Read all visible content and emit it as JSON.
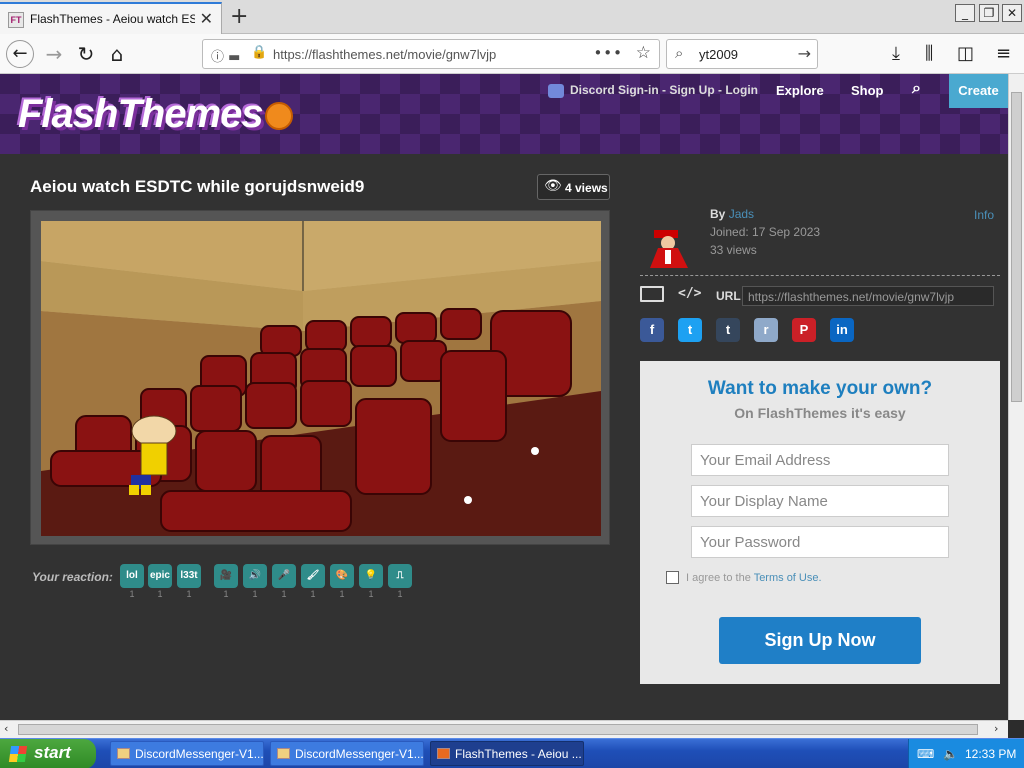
{
  "browser": {
    "tab_title": "FlashThemes - Aeiou watch ESDTC",
    "favicon_text": "FT",
    "url": "https://flashthemes.net/movie/gnw7lvjp",
    "search_value": "yt2009"
  },
  "site": {
    "logo": "FlashThemes",
    "discord_link": "Discord Sign-in - Sign Up - Login",
    "nav": [
      "Explore",
      "Shop"
    ],
    "create_label": "Create"
  },
  "movie": {
    "title": "Aeiou watch ESDTC while gorujdsnweid9",
    "views": "4 views",
    "reaction_label": "Your reaction:",
    "reactions": [
      {
        "label": "lol",
        "count": "1"
      },
      {
        "label": "epic",
        "count": "1"
      },
      {
        "label": "l33t",
        "count": "1"
      },
      {
        "label": "",
        "count": "1",
        "icon": "camera-icon"
      },
      {
        "label": "",
        "count": "1",
        "icon": "speaker-icon"
      },
      {
        "label": "",
        "count": "1",
        "icon": "microphone-icon"
      },
      {
        "label": "",
        "count": "1",
        "icon": "brush-icon"
      },
      {
        "label": "",
        "count": "1",
        "icon": "palette-icon"
      },
      {
        "label": "",
        "count": "1",
        "icon": "lightbulb-icon"
      },
      {
        "label": "",
        "count": "1",
        "icon": "stamp-icon"
      }
    ]
  },
  "author": {
    "by": "By",
    "name": "Jads",
    "joined": "Joined: 17 Sep 2023",
    "views": "33 views",
    "info": "Info"
  },
  "share": {
    "url_label": "URL",
    "url_value": "https://flashthemes.net/movie/gnw7lvjp",
    "embed_label": "</>",
    "networks": [
      {
        "label": "f",
        "color": "#3b5998",
        "icon": "facebook-icon"
      },
      {
        "label": "t",
        "color": "#1da1f2",
        "icon": "twitter-icon"
      },
      {
        "label": "t",
        "color": "#35465c",
        "icon": "tumblr-icon"
      },
      {
        "label": "r",
        "color": "#8fa9c9",
        "icon": "reddit-icon"
      },
      {
        "label": "P",
        "color": "#cb2027",
        "icon": "pinterest-icon"
      },
      {
        "label": "in",
        "color": "#0a66c2",
        "icon": "linkedin-icon"
      }
    ]
  },
  "signup": {
    "heading": "Want to make your own?",
    "subheading": "On FlashThemes it's easy",
    "email_placeholder": "Your Email Address",
    "name_placeholder": "Your Display Name",
    "password_placeholder": "Your Password",
    "agree_text": "I agree to the",
    "terms_link": "Terms of Use.",
    "button": "Sign Up Now"
  },
  "taskbar": {
    "start": "start",
    "items": [
      "DiscordMessenger-V1...",
      "DiscordMessenger-V1...",
      "FlashThemes - Aeiou ..."
    ],
    "clock": "12:33 PM"
  }
}
